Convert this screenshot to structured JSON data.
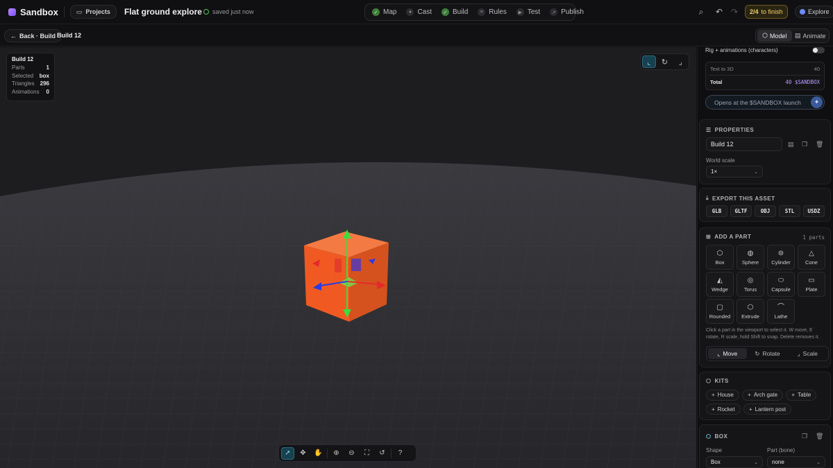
{
  "app": {
    "name": "Sandbox",
    "projects_label": "Projects",
    "project_title": "Flat ground explore",
    "save_status": "saved just now"
  },
  "steps": [
    {
      "label": "Map",
      "state": "done"
    },
    {
      "label": "Cast",
      "state": "todo"
    },
    {
      "label": "Build",
      "state": "done"
    },
    {
      "label": "Rules",
      "state": "todo"
    },
    {
      "label": "Test",
      "state": "todo"
    },
    {
      "label": "Publish",
      "state": "todo"
    }
  ],
  "progress": {
    "label": "2/4",
    "suffix": "to finish"
  },
  "explore_label": "Explore",
  "subbar": {
    "back_label": "Back · Build",
    "title": "Build 12",
    "modes": [
      {
        "label": "Model",
        "active": true
      },
      {
        "label": "Animate",
        "active": false
      }
    ]
  },
  "stats": {
    "title": "Build 12",
    "rows": [
      {
        "k": "Parts",
        "v": "1"
      },
      {
        "k": "Selected",
        "v": "box"
      },
      {
        "k": "Triangles",
        "v": "296"
      },
      {
        "k": "Animations",
        "v": "0"
      }
    ]
  },
  "gizmo": {
    "active": "move",
    "items": [
      "move",
      "rotate",
      "scale"
    ]
  },
  "viewport_tools": [
    "select",
    "move",
    "pan",
    "zoom-in",
    "zoom-out",
    "fit",
    "reset",
    "help"
  ],
  "panel": {
    "rig": {
      "label": "Rig + animations (characters)",
      "enabled": false
    },
    "cost": {
      "rows": [
        {
          "label": "Text to 3D",
          "value": "40"
        }
      ],
      "total_label": "Total",
      "total_value": "40 $SANDBOX"
    },
    "launch_label": "Opens at the $SANDBOX launch",
    "properties": {
      "heading": "PROPERTIES",
      "name_value": "Build 12",
      "scale_label": "World scale",
      "scale_value": "1×"
    },
    "export": {
      "heading": "EXPORT THIS ASSET",
      "formats": [
        "GLB",
        "GLTF",
        "OBJ",
        "STL",
        "USDZ"
      ]
    },
    "add_part": {
      "heading": "ADD A PART",
      "count": "1 parts",
      "parts": [
        {
          "label": "Box",
          "icon": "cube"
        },
        {
          "label": "Sphere",
          "icon": "globe"
        },
        {
          "label": "Cylinder",
          "icon": "cylinder"
        },
        {
          "label": "Cone",
          "icon": "cone"
        },
        {
          "label": "Wedge",
          "icon": "wedge"
        },
        {
          "label": "Torus",
          "icon": "torus"
        },
        {
          "label": "Capsule",
          "icon": "capsule"
        },
        {
          "label": "Plate",
          "icon": "plate"
        },
        {
          "label": "Rounded",
          "icon": "rounded"
        },
        {
          "label": "Extrude",
          "icon": "hexagon"
        },
        {
          "label": "Lathe",
          "icon": "lathe"
        }
      ],
      "hint": "Click a part in the viewport to select it. W move, E rotate, R scale, hold Shift to snap. Delete removes it.",
      "transform": [
        {
          "label": "Move",
          "active": true
        },
        {
          "label": "Rotate",
          "active": false
        },
        {
          "label": "Scale",
          "active": false
        }
      ]
    },
    "kits": {
      "heading": "KITS",
      "items": [
        "House",
        "Arch gate",
        "Table",
        "Rocket",
        "Lantern post"
      ]
    },
    "box": {
      "heading": "BOX",
      "shape_label": "Shape",
      "shape_value": "Box",
      "bone_label": "Part (bone)",
      "bone_value": "none"
    }
  },
  "colors": {
    "accent": "#7fd6f0",
    "cube": "#f05a22",
    "progress": "#f3d36b"
  }
}
